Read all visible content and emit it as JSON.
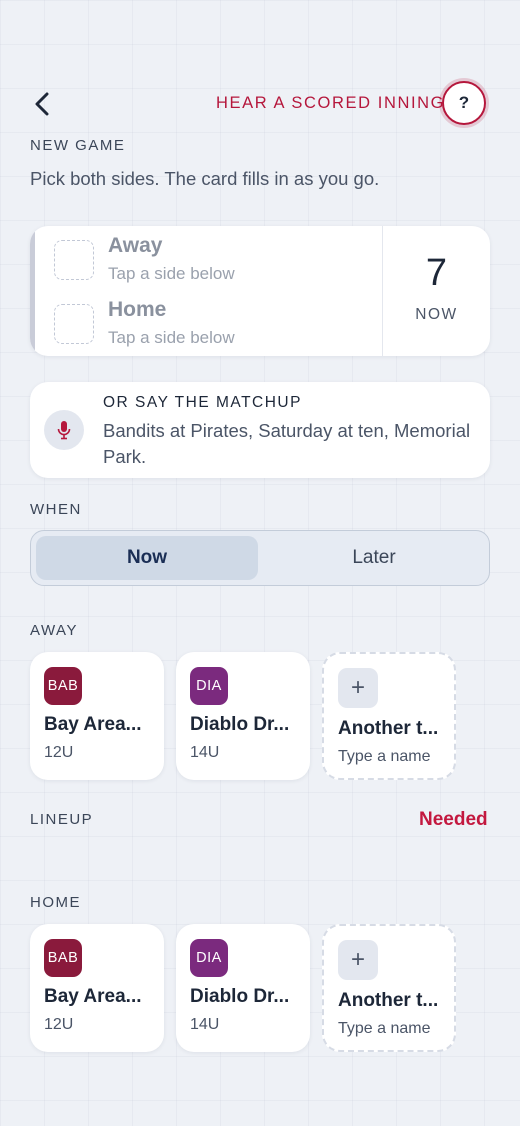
{
  "header": {
    "hear_link": "HEAR A SCORED INNING",
    "help_label": "?"
  },
  "new_game": {
    "label": "NEW GAME",
    "subtitle": "Pick both sides. The card fills in as you go."
  },
  "score_card": {
    "away_label": "Away",
    "away_hint": "Tap a side below",
    "home_label": "Home",
    "home_hint": "Tap a side below",
    "inning": "7",
    "time_label": "NOW"
  },
  "voice": {
    "title": "OR SAY THE MATCHUP",
    "example": "Bandits at Pirates, Saturday at ten, Memorial Park."
  },
  "when": {
    "label": "WHEN",
    "options": [
      "Now",
      "Later"
    ],
    "selected": "Now"
  },
  "away": {
    "label": "AWAY",
    "teams": [
      {
        "abbr": "BAB",
        "name": "Bay Area...",
        "division": "12U",
        "color": "#8a1a3c"
      },
      {
        "abbr": "DIA",
        "name": "Diablo Dr...",
        "division": "14U",
        "color": "#7b2a7e"
      }
    ],
    "add": {
      "name": "Another t...",
      "hint": "Type a name",
      "icon": "+"
    }
  },
  "lineup": {
    "label": "LINEUP",
    "status": "Needed"
  },
  "home": {
    "label": "HOME",
    "teams": [
      {
        "abbr": "BAB",
        "name": "Bay Area...",
        "division": "12U",
        "color": "#8a1a3c"
      },
      {
        "abbr": "DIA",
        "name": "Diablo Dr...",
        "division": "14U",
        "color": "#7b2a7e"
      }
    ],
    "add": {
      "name": "Another t...",
      "hint": "Type a name",
      "icon": "+"
    }
  },
  "colors": {
    "accent": "#b5173c",
    "needed": "#c3183f",
    "selected_segment": "#cfd9e6"
  }
}
